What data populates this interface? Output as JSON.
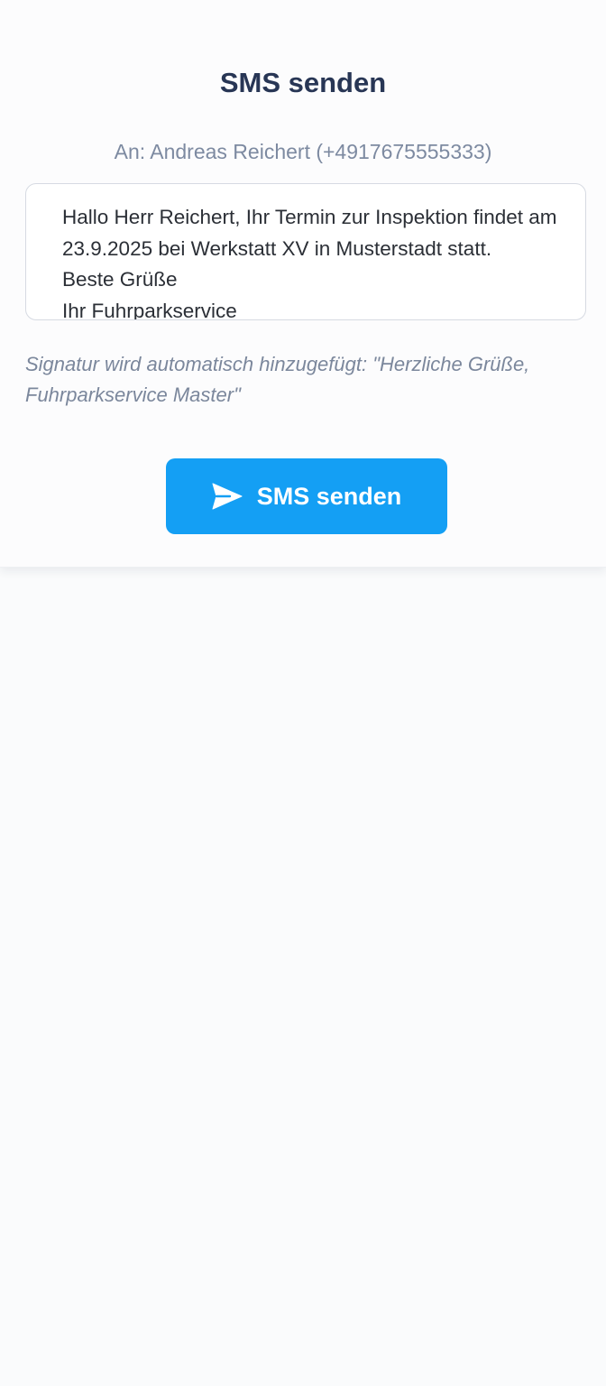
{
  "dialog": {
    "title": "SMS senden",
    "recipient": "An: Andreas Reichert (+4917675555333)",
    "message": "Hallo Herr Reichert, Ihr Termin zur Inspektion findet am 23.9.2025 bei Werkstatt XV in Musterstadt statt.\nBeste Grüße\nIhr Fuhrparkservice",
    "signature_note": "Signatur wird automatisch hinzugefügt: \"Herzliche Grüße, Fuhrparkservice Master\"",
    "send_button": {
      "label": "SMS senden",
      "icon": "send-icon"
    }
  },
  "colors": {
    "title": "#283655",
    "muted": "#7d8aa1",
    "accent": "#149ff4",
    "background": "#fafbfc"
  }
}
